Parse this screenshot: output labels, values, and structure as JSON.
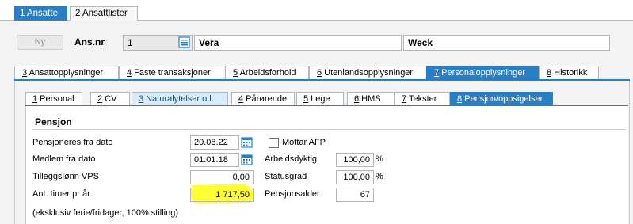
{
  "top_tabs": [
    {
      "num": "1",
      "label": " Ansatte"
    },
    {
      "num": "2",
      "label": " Ansattlister"
    }
  ],
  "header": {
    "new_button": "Ny",
    "ansnr_label": "Ans.nr",
    "ansnr_value": "1",
    "first_name": "Vera",
    "last_name": "Weck"
  },
  "main_tabs": [
    {
      "num": "3",
      "label": " Ansattopplysninger"
    },
    {
      "num": "4",
      "label": " Faste transaksjoner"
    },
    {
      "num": "5",
      "label": " Arbeidsforhold"
    },
    {
      "num": "6",
      "label": " Utenlandsopplysninger"
    },
    {
      "num": "7",
      "label": " Personalopplysninger"
    },
    {
      "num": "8",
      "label": " Historikk"
    }
  ],
  "sub_tabs": [
    {
      "num": "1",
      "label": " Personal"
    },
    {
      "num": "2",
      "label": " CV"
    },
    {
      "num": "3",
      "label": " Naturalytelser o.l."
    },
    {
      "num": "4",
      "label": " Pårørende"
    },
    {
      "num": "5",
      "label": " Lege"
    },
    {
      "num": "6",
      "label": " HMS"
    },
    {
      "num": "7",
      "label": " Tekster"
    },
    {
      "num": "8",
      "label": " Pensjon/oppsigelser"
    }
  ],
  "pension": {
    "title": "Pensjon",
    "pensioned_from_label": "Pensjoneres fra dato",
    "pensioned_from_value": "20.08.22",
    "member_from_label": "Medlem fra dato",
    "member_from_value": "01.01.18",
    "supplement_label": "Tilleggslønn VPS",
    "supplement_value": "0,00",
    "hours_label": "Ant. timer pr år",
    "hours_value": "1 717,50",
    "note": "(eksklusiv ferie/fridager, 100% stilling)",
    "afp_label": "Mottar AFP",
    "work_capacity_label": "Arbeidsdyktig",
    "work_capacity_value": "100,00",
    "status_label": "Statusgrad",
    "status_value": "100,00",
    "percent_sign": "%",
    "pension_age_label": "Pensjonsalder",
    "pension_age_value": "67"
  },
  "colors": {
    "accent": "#2a7ec4",
    "highlight": "#ffff33"
  },
  "icons": [
    "list-icon",
    "calendar-icon",
    "checkbox-icon"
  ]
}
